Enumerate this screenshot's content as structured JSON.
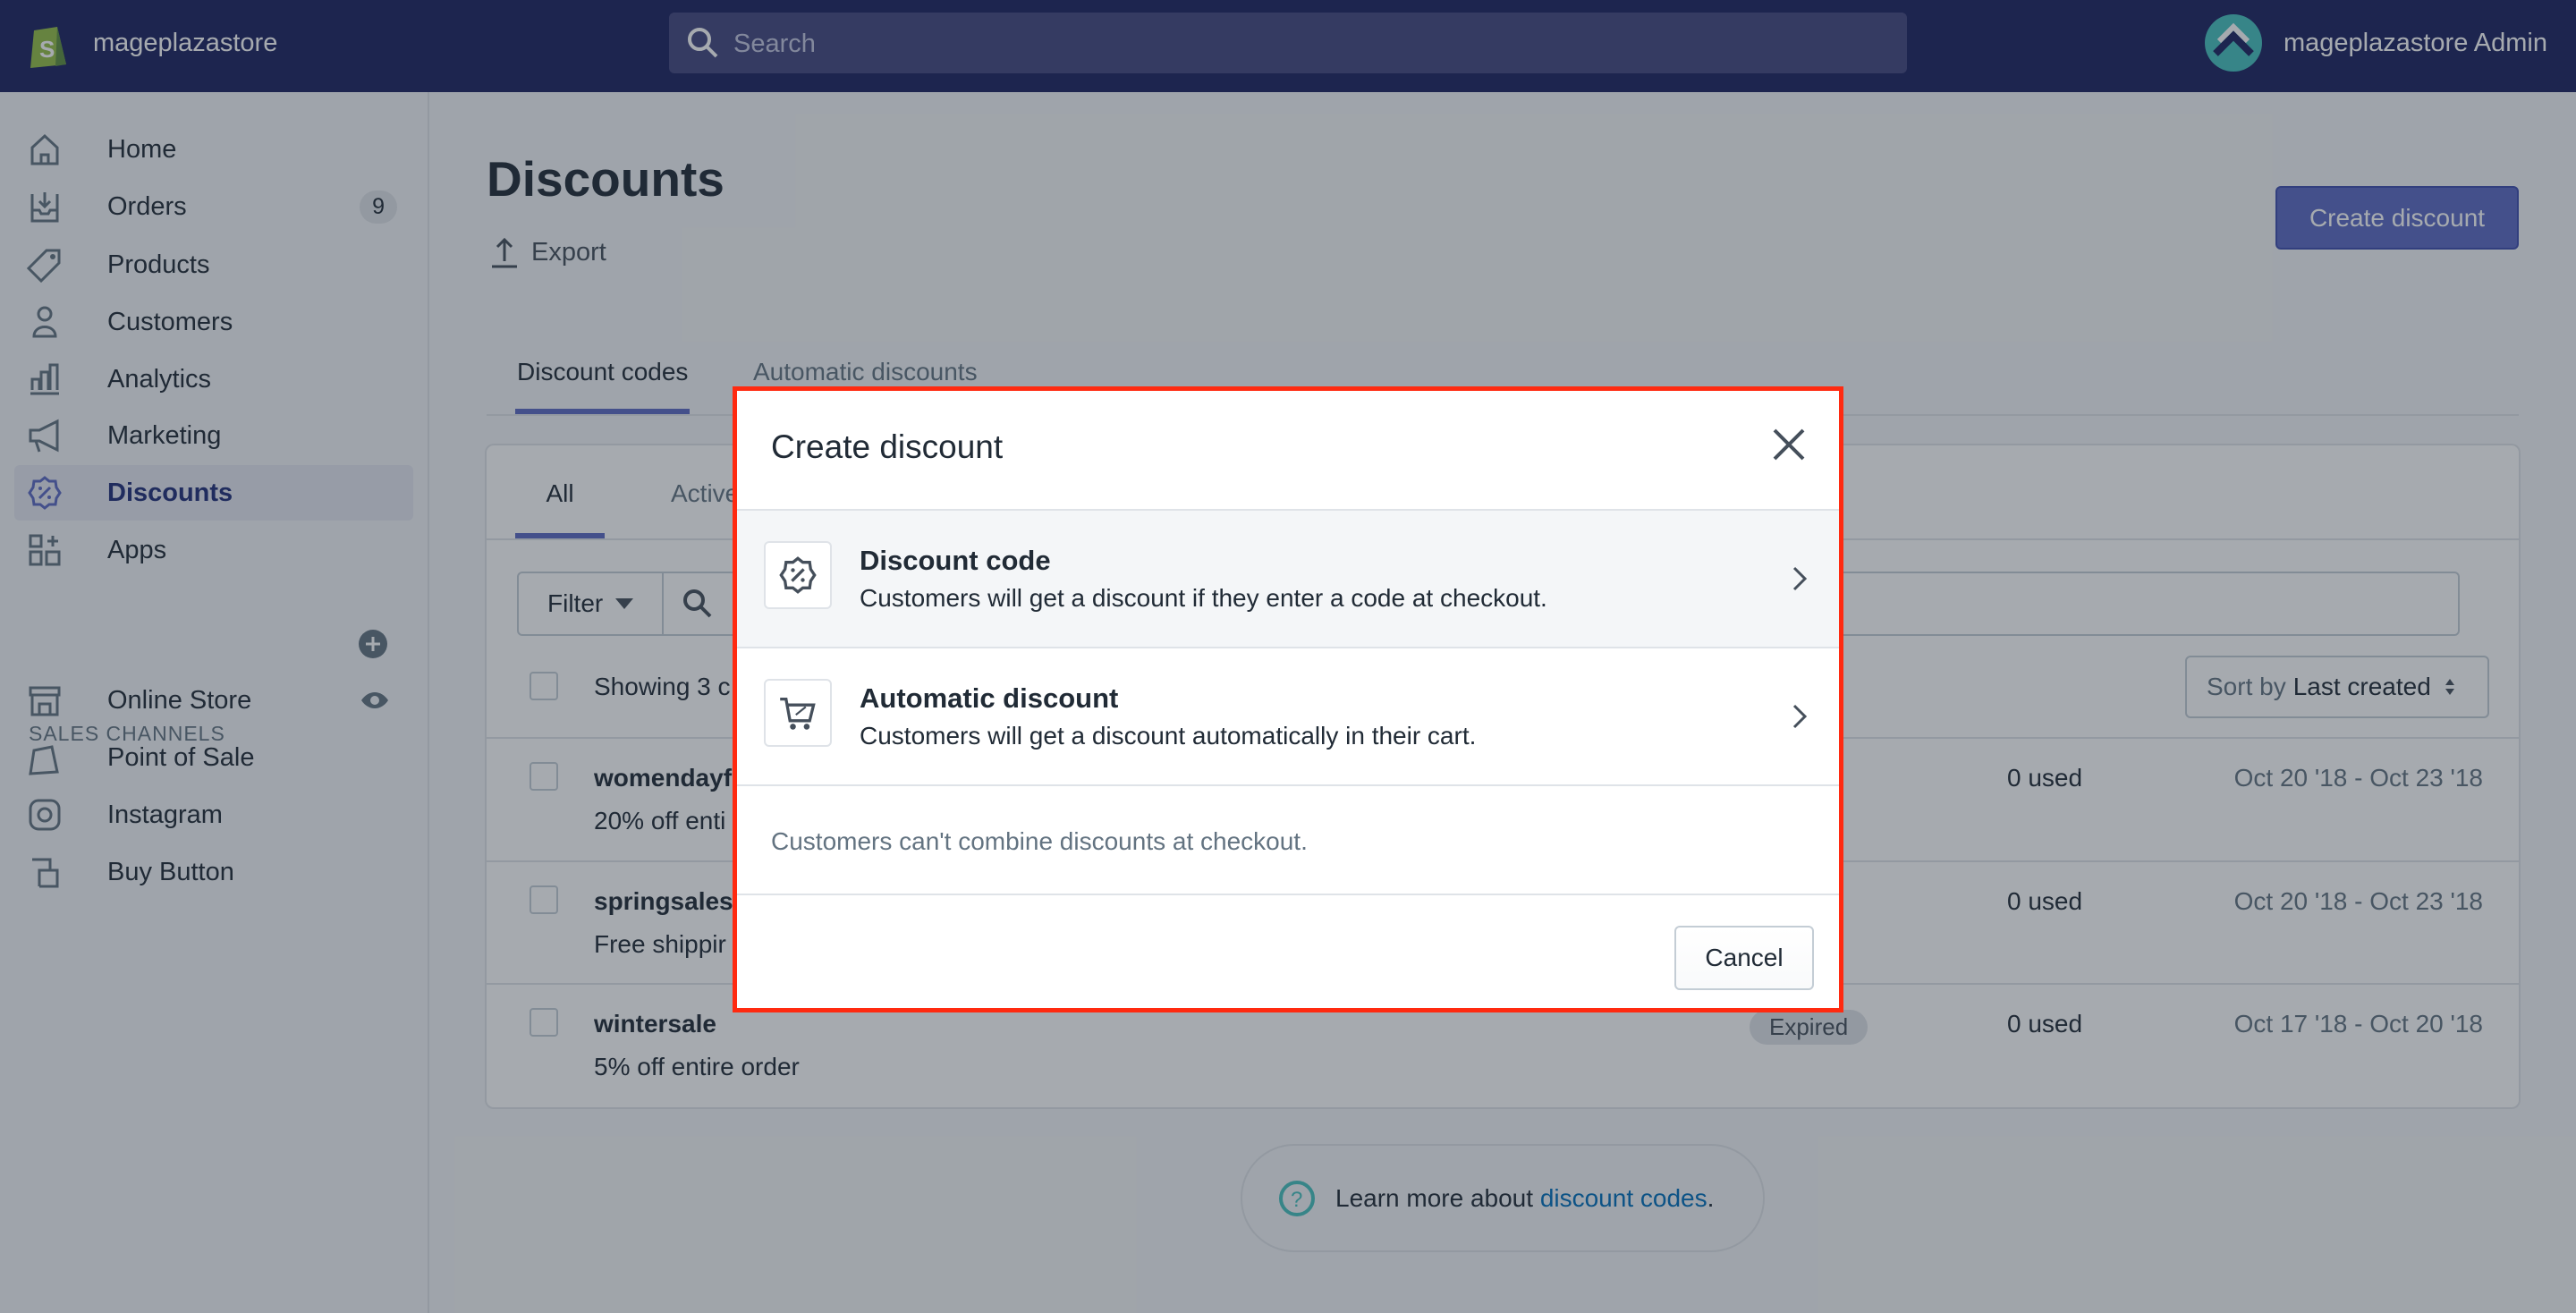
{
  "topbar": {
    "store_name": "mageplazastore",
    "search_placeholder": "Search",
    "admin_name": "mageplazastore Admin"
  },
  "sidebar": {
    "items": [
      {
        "label": "Home",
        "icon": "home-icon"
      },
      {
        "label": "Orders",
        "icon": "orders-icon",
        "badge": "9"
      },
      {
        "label": "Products",
        "icon": "tag-icon"
      },
      {
        "label": "Customers",
        "icon": "person-icon"
      },
      {
        "label": "Analytics",
        "icon": "chart-icon"
      },
      {
        "label": "Marketing",
        "icon": "megaphone-icon"
      },
      {
        "label": "Discounts",
        "icon": "discount-icon",
        "active": true
      },
      {
        "label": "Apps",
        "icon": "apps-icon"
      }
    ],
    "sales_channels_header": "SALES CHANNELS",
    "channels": [
      {
        "label": "Online Store",
        "icon": "store-icon"
      },
      {
        "label": "Point of Sale",
        "icon": "bag-icon"
      },
      {
        "label": "Instagram",
        "icon": "instagram-icon"
      },
      {
        "label": "Buy Button",
        "icon": "buy-button-icon"
      }
    ]
  },
  "page": {
    "title": "Discounts",
    "export_label": "Export",
    "create_label": "Create discount",
    "tabs": [
      "Discount codes",
      "Automatic discounts"
    ],
    "inner_tabs": [
      "All",
      "Active"
    ],
    "filter_label": "Filter",
    "showing_text": "Showing 3 c",
    "sort_prefix": "Sort by",
    "sort_value": "Last created",
    "rows": [
      {
        "code": "womendayf",
        "desc": "20% off enti",
        "status": "",
        "used": "0 used",
        "dates": "Oct 20 '18 - Oct 23 '18"
      },
      {
        "code": "springsales",
        "desc": "Free shippir",
        "status": "",
        "used": "0 used",
        "dates": "Oct 20 '18 - Oct 23 '18"
      },
      {
        "code": "wintersale",
        "desc": "5% off entire order",
        "status": "Expired",
        "used": "0 used",
        "dates": "Oct 17 '18 - Oct 20 '18"
      }
    ],
    "learn_prefix": "Learn more about ",
    "learn_link": "discount codes",
    "learn_suffix": "."
  },
  "modal": {
    "title": "Create discount",
    "options": [
      {
        "title": "Discount code",
        "desc": "Customers will get a discount if they enter a code at checkout."
      },
      {
        "title": "Automatic discount",
        "desc": "Customers will get a discount automatically in their cart."
      }
    ],
    "note": "Customers can't combine discounts at checkout.",
    "cancel_label": "Cancel"
  },
  "colors": {
    "topbar": "#1c2260",
    "accent": "#5c6ac4",
    "highlight_border": "#ff2a10",
    "link": "#006fbb"
  }
}
